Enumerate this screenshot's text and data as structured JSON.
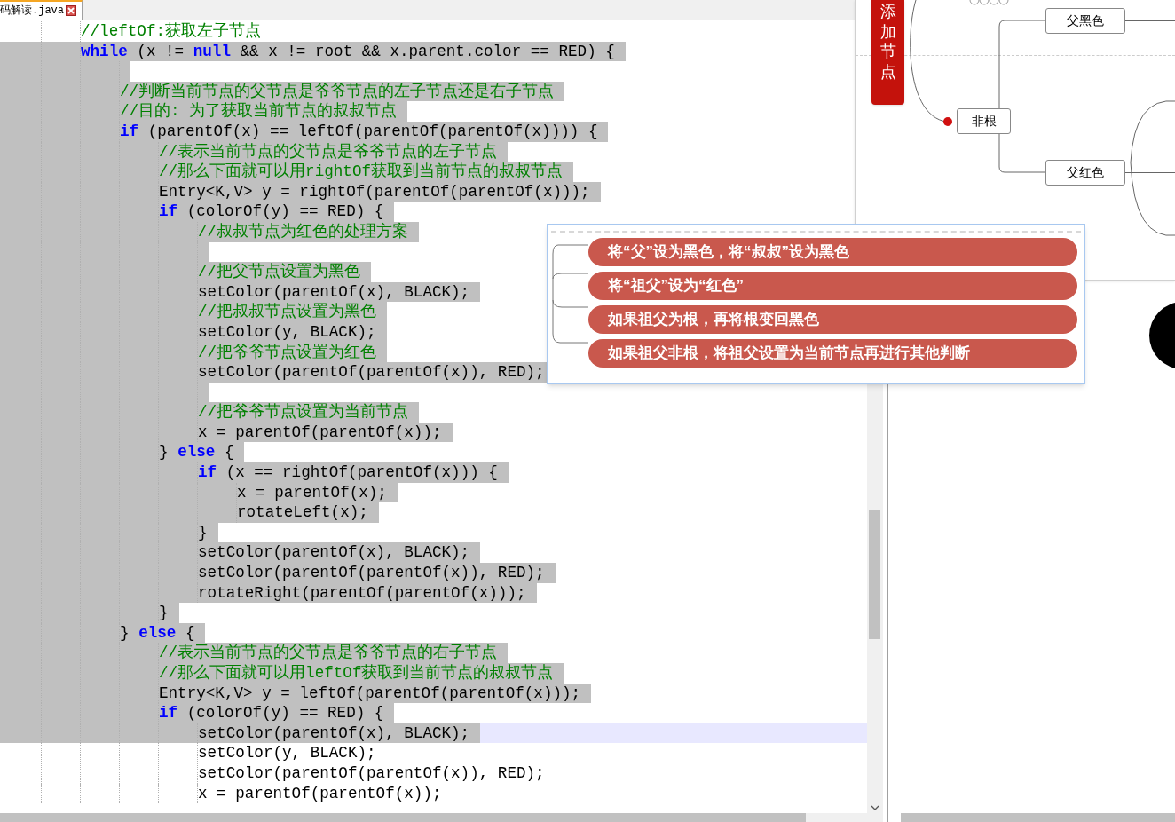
{
  "tab": {
    "label": "码解读.java"
  },
  "code_lines": [
    {
      "selected": false,
      "current": false,
      "parts": [
        {
          "kind": "comment",
          "text": "//leftOf:获取左子节点"
        }
      ]
    },
    {
      "selected": true,
      "current": false,
      "parts": [
        {
          "kind": "keyword",
          "text": "while"
        },
        {
          "kind": "plain",
          "text": " (x != "
        },
        {
          "kind": "keyword",
          "text": "null"
        },
        {
          "kind": "plain",
          "text": " && x != root && x.parent.color == RED) {"
        }
      ],
      "children": [
        {
          "selected": true,
          "current": false
        },
        {
          "selected": true,
          "current": false,
          "parts": [
            {
              "kind": "comment",
              "text": "//判断当前节点的父节点是爷爷节点的左子节点还是右子节点"
            }
          ]
        },
        {
          "selected": true,
          "current": false,
          "parts": [
            {
              "kind": "comment",
              "text": "//目的: 为了获取当前节点的叔叔节点"
            }
          ]
        },
        {
          "selected": true,
          "current": false,
          "parts": [
            {
              "kind": "keyword",
              "text": "if"
            },
            {
              "kind": "plain",
              "text": " (parentOf(x) == leftOf(parentOf(parentOf(x)))) {"
            }
          ],
          "children": [
            {
              "selected": true,
              "current": false,
              "parts": [
                {
                  "kind": "comment",
                  "text": "//表示当前节点的父节点是爷爷节点的左子节点"
                }
              ]
            },
            {
              "selected": true,
              "current": false,
              "parts": [
                {
                  "kind": "comment",
                  "text": "//那么下面就可以用rightOf获取到当前节点的叔叔节点"
                }
              ]
            },
            {
              "selected": true,
              "current": false,
              "parts": [
                {
                  "kind": "plain",
                  "text": "Entry<K,V> y = rightOf(parentOf(parentOf(x)));"
                }
              ]
            },
            {
              "selected": true,
              "current": false,
              "parts": [
                {
                  "kind": "keyword",
                  "text": "if"
                },
                {
                  "kind": "plain",
                  "text": " (colorOf(y) == RED) {"
                }
              ],
              "children": [
                {
                  "selected": true,
                  "current": false,
                  "parts": [
                    {
                      "kind": "comment",
                      "text": "//叔叔节点为红色的处理方案"
                    }
                  ]
                },
                {
                  "selected": true,
                  "current": false
                },
                {
                  "selected": true,
                  "current": false,
                  "parts": [
                    {
                      "kind": "comment",
                      "text": "//把父节点设置为黑色"
                    }
                  ]
                },
                {
                  "selected": true,
                  "current": false,
                  "parts": [
                    {
                      "kind": "plain",
                      "text": "setColor(parentOf(x), BLACK);"
                    }
                  ]
                },
                {
                  "selected": true,
                  "current": false,
                  "parts": [
                    {
                      "kind": "comment",
                      "text": "//把叔叔节点设置为黑色"
                    }
                  ]
                },
                {
                  "selected": true,
                  "current": false,
                  "parts": [
                    {
                      "kind": "plain",
                      "text": "setColor(y, BLACK);"
                    }
                  ]
                },
                {
                  "selected": true,
                  "current": false,
                  "parts": [
                    {
                      "kind": "comment",
                      "text": "//把爷爷节点设置为红色"
                    }
                  ]
                },
                {
                  "selected": true,
                  "current": false,
                  "parts": [
                    {
                      "kind": "plain",
                      "text": "setColor(parentOf(parentOf(x)), RED);"
                    }
                  ]
                },
                {
                  "selected": true,
                  "current": false
                },
                {
                  "selected": true,
                  "current": false,
                  "parts": [
                    {
                      "kind": "comment",
                      "text": "//把爷爷节点设置为当前节点"
                    }
                  ]
                },
                {
                  "selected": true,
                  "current": false,
                  "parts": [
                    {
                      "kind": "plain",
                      "text": "x = parentOf(parentOf(x));"
                    }
                  ]
                }
              ]
            },
            {
              "selected": true,
              "current": false,
              "parts": [
                {
                  "kind": "plain",
                  "text": "} "
                },
                {
                  "kind": "keyword",
                  "text": "else"
                },
                {
                  "kind": "plain",
                  "text": " {"
                }
              ],
              "children": [
                {
                  "selected": true,
                  "current": false,
                  "parts": [
                    {
                      "kind": "keyword",
                      "text": "if"
                    },
                    {
                      "kind": "plain",
                      "text": " (x == rightOf(parentOf(x))) {"
                    }
                  ],
                  "children": [
                    {
                      "selected": true,
                      "current": false,
                      "parts": [
                        {
                          "kind": "plain",
                          "text": "x = parentOf(x);"
                        }
                      ]
                    },
                    {
                      "selected": true,
                      "current": false,
                      "parts": [
                        {
                          "kind": "plain",
                          "text": "rotateLeft(x);"
                        }
                      ]
                    }
                  ]
                },
                {
                  "selected": true,
                  "current": false,
                  "parts": [
                    {
                      "kind": "plain",
                      "text": "}"
                    }
                  ]
                },
                {
                  "selected": true,
                  "current": false,
                  "parts": [
                    {
                      "kind": "plain",
                      "text": "setColor(parentOf(x), BLACK);"
                    }
                  ]
                },
                {
                  "selected": true,
                  "current": false,
                  "parts": [
                    {
                      "kind": "plain",
                      "text": "setColor(parentOf(parentOf(x)), RED);"
                    }
                  ]
                },
                {
                  "selected": true,
                  "current": false,
                  "parts": [
                    {
                      "kind": "plain",
                      "text": "rotateRight(parentOf(parentOf(x)));"
                    }
                  ]
                }
              ]
            },
            {
              "selected": true,
              "current": false,
              "parts": [
                {
                  "kind": "plain",
                  "text": "}"
                }
              ]
            }
          ]
        },
        {
          "selected": true,
          "current": false,
          "parts": [
            {
              "kind": "plain",
              "text": "} "
            },
            {
              "kind": "keyword",
              "text": "else"
            },
            {
              "kind": "plain",
              "text": " {"
            }
          ],
          "children": [
            {
              "selected": true,
              "current": false,
              "parts": [
                {
                  "kind": "comment",
                  "text": "//表示当前节点的父节点是爷爷节点的右子节点"
                }
              ]
            },
            {
              "selected": true,
              "current": false,
              "parts": [
                {
                  "kind": "comment",
                  "text": "//那么下面就可以用leftOf获取到当前节点的叔叔节点"
                }
              ]
            },
            {
              "selected": true,
              "current": false,
              "parts": [
                {
                  "kind": "plain",
                  "text": "Entry<K,V> y = leftOf(parentOf(parentOf(x)));"
                }
              ]
            },
            {
              "selected": true,
              "current": false,
              "parts": [
                {
                  "kind": "keyword",
                  "text": "if"
                },
                {
                  "kind": "plain",
                  "text": " (colorOf(y) == RED) {"
                }
              ],
              "children": [
                {
                  "selected": true,
                  "current": true,
                  "parts": [
                    {
                      "kind": "plain",
                      "text": "setColor(parentOf(x), BLACK);"
                    }
                  ]
                },
                {
                  "selected": false,
                  "current": false,
                  "parts": [
                    {
                      "kind": "plain",
                      "text": "setColor(y, BLACK);"
                    }
                  ]
                },
                {
                  "selected": false,
                  "current": false,
                  "parts": [
                    {
                      "kind": "plain",
                      "text": "setColor(parentOf(parentOf(x)), RED);"
                    }
                  ]
                },
                {
                  "selected": false,
                  "current": false,
                  "parts": [
                    {
                      "kind": "plain",
                      "text": "x = parentOf(parentOf(x));"
                    }
                  ]
                }
              ]
            }
          ]
        }
      ]
    }
  ],
  "mind_map": {
    "tag": "添加节点",
    "nodes": [
      {
        "label": "非根"
      },
      {
        "label": "父黑色"
      },
      {
        "label": "父红色"
      }
    ]
  },
  "popup": {
    "items": [
      "将“父”设为黑色，将“叔叔”设为黑色",
      "将“祖父”设为“红色”",
      "如果祖父为根，再将根变回黑色",
      "如果祖父非根，将祖父设置为当前节点再进行其他判断"
    ]
  }
}
